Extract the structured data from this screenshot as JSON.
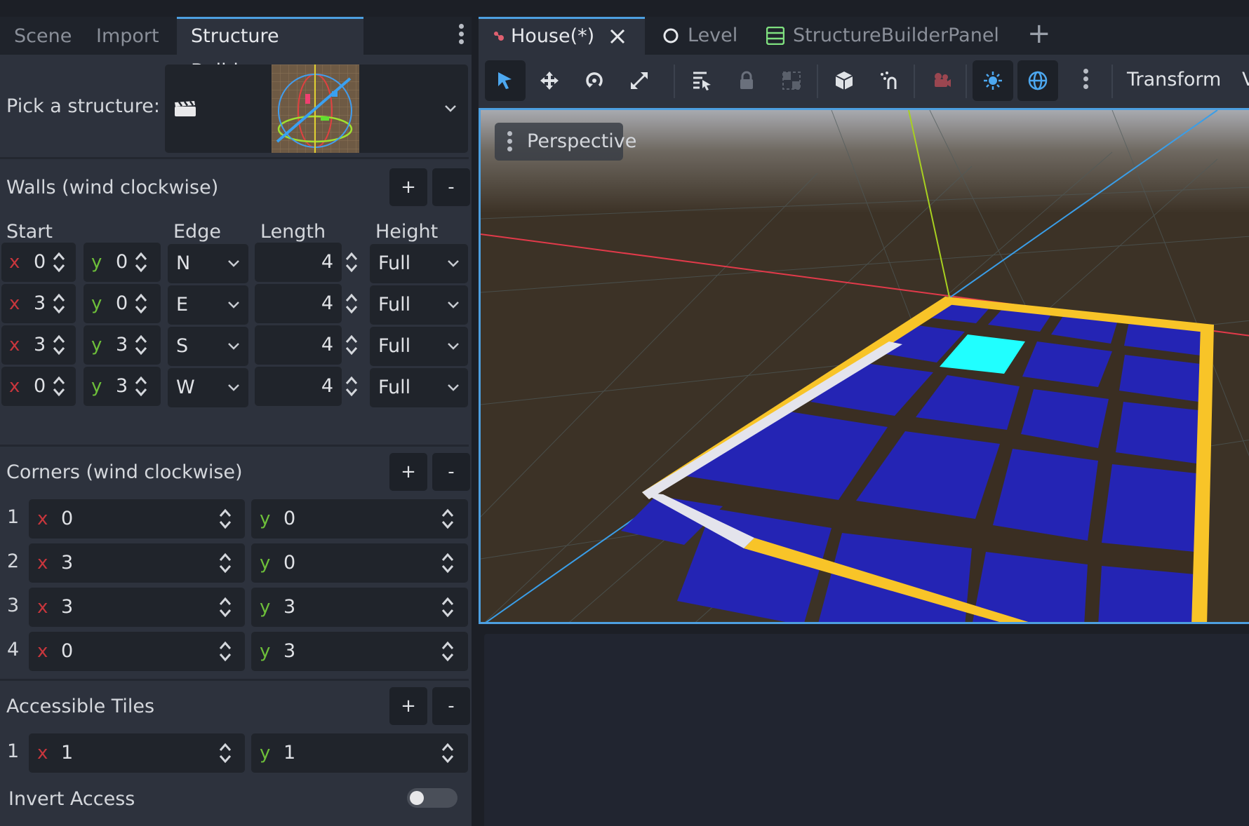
{
  "dock": {
    "tabs": [
      "Scene",
      "Import",
      "Structure Builder"
    ],
    "pick_label": "Pick a structure:",
    "walls": {
      "title": "Walls (wind clockwise)",
      "add": "+",
      "remove": "-",
      "columns": [
        "Start",
        "Edge",
        "Length",
        "Height"
      ],
      "rows": [
        {
          "x": "0",
          "y": "0",
          "edge": "N",
          "length": "4",
          "height": "Full"
        },
        {
          "x": "3",
          "y": "0",
          "edge": "E",
          "length": "4",
          "height": "Full"
        },
        {
          "x": "3",
          "y": "3",
          "edge": "S",
          "length": "4",
          "height": "Full"
        },
        {
          "x": "0",
          "y": "3",
          "edge": "W",
          "length": "4",
          "height": "Full"
        }
      ]
    },
    "corners": {
      "title": "Corners (wind clockwise)",
      "add": "+",
      "remove": "-",
      "rows": [
        {
          "n": "1",
          "x": "0",
          "y": "0"
        },
        {
          "n": "2",
          "x": "3",
          "y": "0"
        },
        {
          "n": "3",
          "x": "3",
          "y": "3"
        },
        {
          "n": "4",
          "x": "0",
          "y": "3"
        }
      ]
    },
    "tiles": {
      "title": "Accessible Tiles",
      "add": "+",
      "remove": "-",
      "rows": [
        {
          "n": "1",
          "x": "1",
          "y": "1"
        }
      ]
    },
    "invert_label": "Invert Access",
    "invert_on": false,
    "axis_x": "x",
    "axis_y": "y"
  },
  "editor": {
    "tabs": [
      {
        "label": "House(*)",
        "icon": "scene-icon",
        "active": true
      },
      {
        "label": "Level",
        "icon": "circle-icon",
        "active": false
      },
      {
        "label": "StructureBuilderPanel",
        "icon": "list-icon",
        "active": false
      }
    ],
    "new_tab": "+",
    "toolbar_menu": "Transform",
    "viewport_label": "Perspective"
  },
  "colors": {
    "accent": "#4d9fe0",
    "floor_tile": "#2424b4",
    "accessible_tile": "#20ffff",
    "wall_highlight": "#f8c428",
    "ground": "#3c3226"
  }
}
